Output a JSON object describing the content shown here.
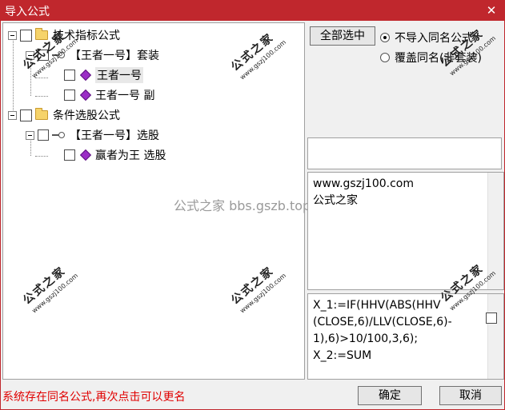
{
  "window": {
    "title": "导入公式",
    "close_glyph": "✕"
  },
  "tree": {
    "nodes": [
      {
        "label": "技术指标公式"
      },
      {
        "label": "【王者一号】套装"
      },
      {
        "label": "王者一号"
      },
      {
        "label": "王者一号 副"
      },
      {
        "label": "条件选股公式"
      },
      {
        "label": "【王者一号】选股"
      },
      {
        "label": "赢者为王 选股"
      }
    ]
  },
  "center_watermark": "公式之家 bbs.gszb.top",
  "watermark": {
    "cn": "公式之家",
    "url": "www.gszj100.com"
  },
  "right": {
    "select_all_label": "全部选中",
    "radio_skip_label": "不导入同名公式",
    "radio_overwrite_label": "覆盖同名(非套装)",
    "info_text": "www.gszj100.com\n公式之家",
    "formula_text": "X_1:=IF(HHV(ABS(HHV\n(CLOSE,6)/LLV(CLOSE,6)-\n1),6)>10/100,3,6);\nX_2:=SUM"
  },
  "status_text": "系统存在同名公式,再次点击可以更名",
  "buttons": {
    "ok": "确定",
    "cancel": "取消"
  }
}
